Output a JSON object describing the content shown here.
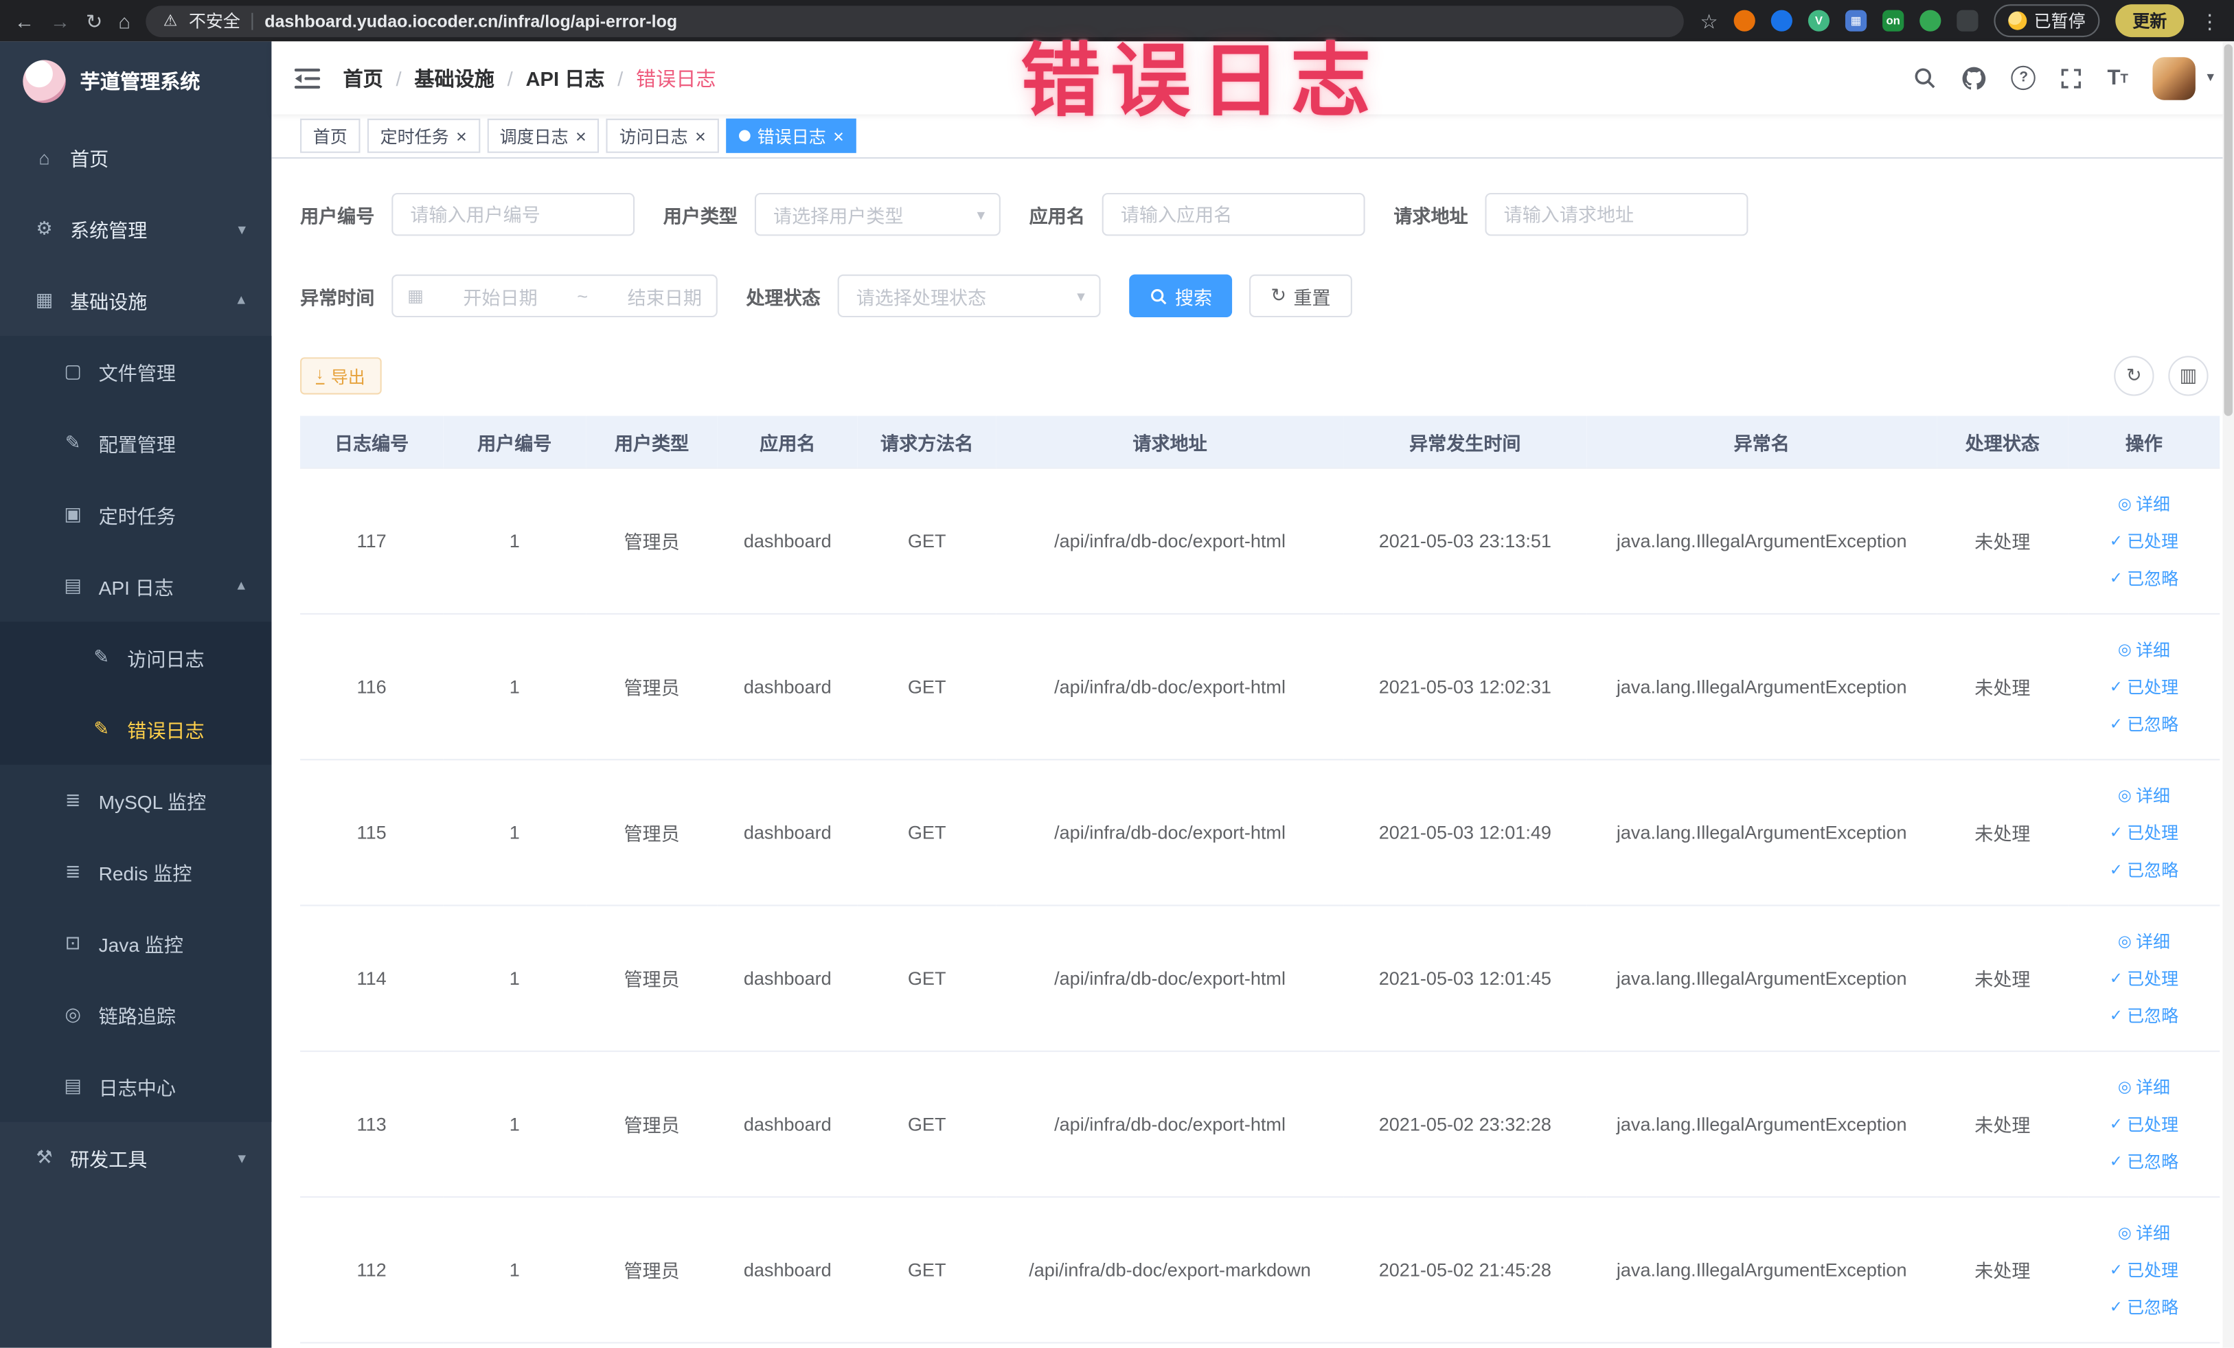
{
  "colors": {
    "accent": "#409eff",
    "sidebar_bg": "#2d3a4b",
    "sidebar_child_bg": "#263445",
    "sidebar_grandchild_bg": "#1f2c3d",
    "active_menu": "#ffd04b",
    "warning": "#e6a23c",
    "annotation": "#e83a5d"
  },
  "annotation_text": "错误日志",
  "browser": {
    "security_label": "不安全",
    "url": "dashboard.yudao.iocoder.cn/infra/log/api-error-log",
    "extension_on_badge": "on",
    "paused_badge": "已暂停",
    "update_label": "更新"
  },
  "sidebar": {
    "logo_title": "芋道管理系统",
    "menu": [
      {
        "label": "首页",
        "level": 1,
        "icon": "home-icon",
        "glyph": "⌂"
      },
      {
        "label": "系统管理",
        "level": 1,
        "icon": "gear-icon",
        "glyph": "⚙",
        "arrow": "down"
      },
      {
        "label": "基础设施",
        "level": 1,
        "icon": "infrastructure-icon",
        "glyph": "▦",
        "arrow": "up"
      },
      {
        "label": "文件管理",
        "level": 2,
        "icon": "file-management-icon",
        "glyph": "▢"
      },
      {
        "label": "配置管理",
        "level": 2,
        "icon": "config-management-icon",
        "glyph": "✎"
      },
      {
        "label": "定时任务",
        "level": 2,
        "icon": "scheduled-task-icon",
        "glyph": "▣"
      },
      {
        "label": "API 日志",
        "level": 2,
        "icon": "api-log-icon",
        "glyph": "▤",
        "arrow": "up"
      },
      {
        "label": "访问日志",
        "level": 3,
        "icon": "access-log-icon",
        "glyph": "✎"
      },
      {
        "label": "错误日志",
        "level": 3,
        "icon": "error-log-icon",
        "glyph": "✎",
        "active": true
      },
      {
        "label": "MySQL 监控",
        "level": 2,
        "icon": "mysql-monitor-icon",
        "glyph": "≣"
      },
      {
        "label": "Redis 监控",
        "level": 2,
        "icon": "redis-monitor-icon",
        "glyph": "≣"
      },
      {
        "label": "Java 监控",
        "level": 2,
        "icon": "java-monitor-icon",
        "glyph": "⊡"
      },
      {
        "label": "链路追踪",
        "level": 2,
        "icon": "trace-icon",
        "glyph": "◎"
      },
      {
        "label": "日志中心",
        "level": 2,
        "icon": "log-center-icon",
        "glyph": "▤"
      },
      {
        "label": "研发工具",
        "level": 1,
        "icon": "devtools-icon",
        "glyph": "⚒",
        "arrow": "down"
      }
    ]
  },
  "header": {
    "breadcrumb": [
      "首页",
      "基础设施",
      "API 日志",
      "错误日志"
    ]
  },
  "tabs": [
    {
      "label": "首页"
    },
    {
      "label": "定时任务",
      "closable": true
    },
    {
      "label": "调度日志",
      "closable": true
    },
    {
      "label": "访问日志",
      "closable": true
    },
    {
      "label": "错误日志",
      "closable": true,
      "active": true
    }
  ],
  "filters": {
    "user_id": {
      "label": "用户编号",
      "placeholder": "请输入用户编号"
    },
    "user_type": {
      "label": "用户类型",
      "placeholder": "请选择用户类型"
    },
    "app_name": {
      "label": "应用名",
      "placeholder": "请输入应用名"
    },
    "request_url": {
      "label": "请求地址",
      "placeholder": "请输入请求地址"
    },
    "exception_time": {
      "label": "异常时间",
      "start_placeholder": "开始日期",
      "separator": "~",
      "end_placeholder": "结束日期"
    },
    "process_status": {
      "label": "处理状态",
      "placeholder": "请选择处理状态"
    },
    "search_label": "搜索",
    "reset_label": "重置"
  },
  "toolbar": {
    "export_label": "导出"
  },
  "table": {
    "columns": [
      "日志编号",
      "用户编号",
      "用户类型",
      "应用名",
      "请求方法名",
      "请求地址",
      "异常发生时间",
      "异常名",
      "处理状态",
      "操作"
    ],
    "action_labels": [
      "详细",
      "已处理",
      "已忽略"
    ],
    "rows": [
      {
        "id": "117",
        "user_id": "1",
        "user_type": "管理员",
        "app": "dashboard",
        "method": "GET",
        "url": "/api/infra/db-doc/export-html",
        "time": "2021-05-03 23:13:51",
        "exception": "java.lang.IllegalArgumentException",
        "status": "未处理"
      },
      {
        "id": "116",
        "user_id": "1",
        "user_type": "管理员",
        "app": "dashboard",
        "method": "GET",
        "url": "/api/infra/db-doc/export-html",
        "time": "2021-05-03 12:02:31",
        "exception": "java.lang.IllegalArgumentException",
        "status": "未处理"
      },
      {
        "id": "115",
        "user_id": "1",
        "user_type": "管理员",
        "app": "dashboard",
        "method": "GET",
        "url": "/api/infra/db-doc/export-html",
        "time": "2021-05-03 12:01:49",
        "exception": "java.lang.IllegalArgumentException",
        "status": "未处理"
      },
      {
        "id": "114",
        "user_id": "1",
        "user_type": "管理员",
        "app": "dashboard",
        "method": "GET",
        "url": "/api/infra/db-doc/export-html",
        "time": "2021-05-03 12:01:45",
        "exception": "java.lang.IllegalArgumentException",
        "status": "未处理"
      },
      {
        "id": "113",
        "user_id": "1",
        "user_type": "管理员",
        "app": "dashboard",
        "method": "GET",
        "url": "/api/infra/db-doc/export-html",
        "time": "2021-05-02 23:32:28",
        "exception": "java.lang.IllegalArgumentException",
        "status": "未处理"
      },
      {
        "id": "112",
        "user_id": "1",
        "user_type": "管理员",
        "app": "dashboard",
        "method": "GET",
        "url": "/api/infra/db-doc/export-markdown",
        "time": "2021-05-02 21:45:28",
        "exception": "java.lang.IllegalArgumentException",
        "status": "未处理"
      }
    ]
  }
}
